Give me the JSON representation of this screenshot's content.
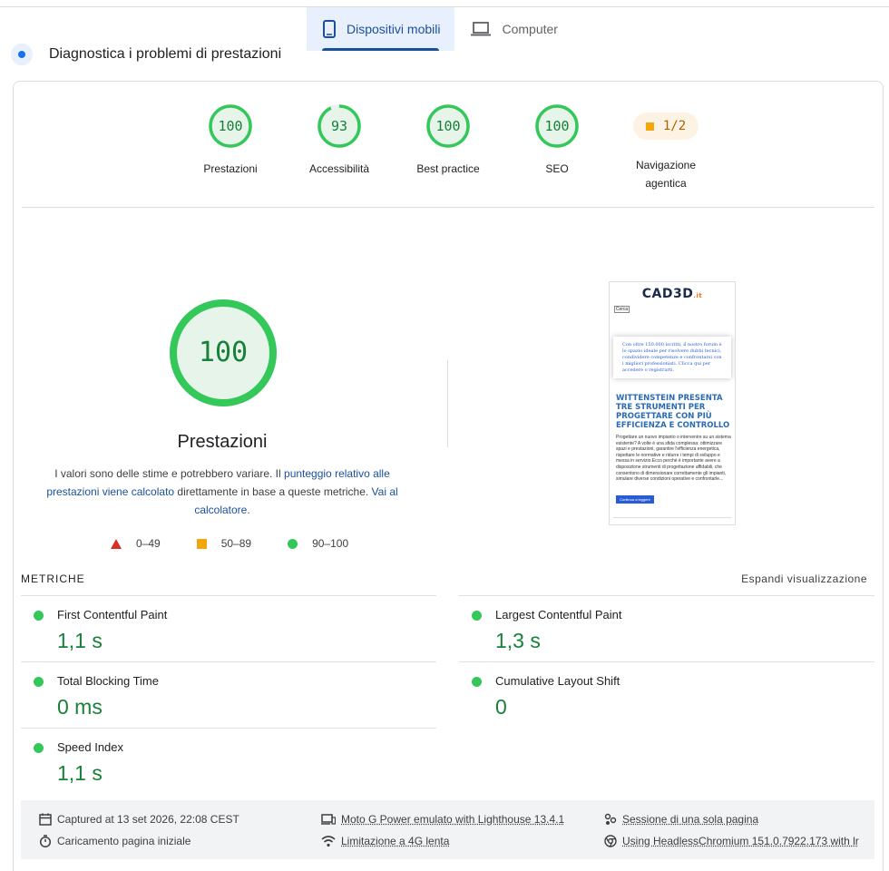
{
  "tabs": [
    {
      "label": "Dispositivi mobili",
      "icon": "smartphone-icon",
      "active": true
    },
    {
      "label": "Computer",
      "icon": "laptop-icon",
      "active": false
    }
  ],
  "diagnostics_title": "Diagnostica i problemi di prestazioni",
  "categories": [
    {
      "label": "Prestazioni",
      "score": "100"
    },
    {
      "label": "Accessibilità",
      "score": "93"
    },
    {
      "label": "Best practice",
      "score": "100"
    },
    {
      "label": "SEO",
      "score": "100"
    },
    {
      "label_line1": "Navigazione",
      "label_line2": "agentica",
      "score": "1/2"
    }
  ],
  "performance": {
    "score": "100",
    "title": "Prestazioni",
    "desc_part1": "I valori sono delle stime e potrebbero variare. Il ",
    "desc_link1": "punteggio relativo alle prestazioni viene calcolato",
    "desc_part2": " direttamente in base a queste metriche. ",
    "desc_link2": "Vai al calcolatore",
    "desc_part3": "."
  },
  "legend": {
    "fail": "0–49",
    "average": "50–89",
    "pass": "90–100"
  },
  "screenshot": {
    "logo": "CAD3D",
    "logo_suffix": ".it",
    "search": "Cerca",
    "banner": "Con oltre 150.000 iscritti, il nostro forum è lo spazio ideale per risolvere dubbi tecnici, condividere competenze e confrontarsi con i migliori professionisti. Clicca qui per accedere o registrarti.",
    "headline": "WITTENSTEIN PRESENTA TRE STRUMENTI PER PROGETTARE CON PIÙ EFFICIENZA E CONTROLLO",
    "body": "Progettare un nuovo impianto o intervenire su un sistema esistente? A volte è una sfida complessa: ottimizzare spazi e prestazioni, garantire l'efficienza energetica, rispettare le normative e ridurre i tempi di sviluppo e messa in servizio.Ecco perché è importante avere a disposizione strumenti di progettazione affidabili, che consentono di dimensionare correttamente gli impianti, simulare diverse condizioni operative e confrontarle...",
    "button": "Continua a leggere"
  },
  "metrics_title": "METRICHE",
  "expand_label": "Espandi visualizzazione",
  "metrics": [
    {
      "name": "First Contentful Paint",
      "value": "1,1 s"
    },
    {
      "name": "Largest Contentful Paint",
      "value": "1,3 s"
    },
    {
      "name": "Total Blocking Time",
      "value": "0 ms"
    },
    {
      "name": "Cumulative Layout Shift",
      "value": "0"
    },
    {
      "name": "Speed Index",
      "value": "1,1 s"
    }
  ],
  "footer": {
    "captured": "Captured at 13 set 2026, 22:08 CEST",
    "load": "Caricamento pagina iniziale",
    "device": "Moto G Power emulato with Lighthouse 13.4.1",
    "throttling": "Limitazione a 4G lenta",
    "session": "Sessione di una sola pagina",
    "browser": "Using HeadlessChromium 151.0.7922.173 with lr"
  },
  "colors": {
    "pass": "#0cce6b",
    "pass_text": "#188038",
    "average": "#f2a60c",
    "fail": "#d93025",
    "accent": "#1a4f9c"
  }
}
